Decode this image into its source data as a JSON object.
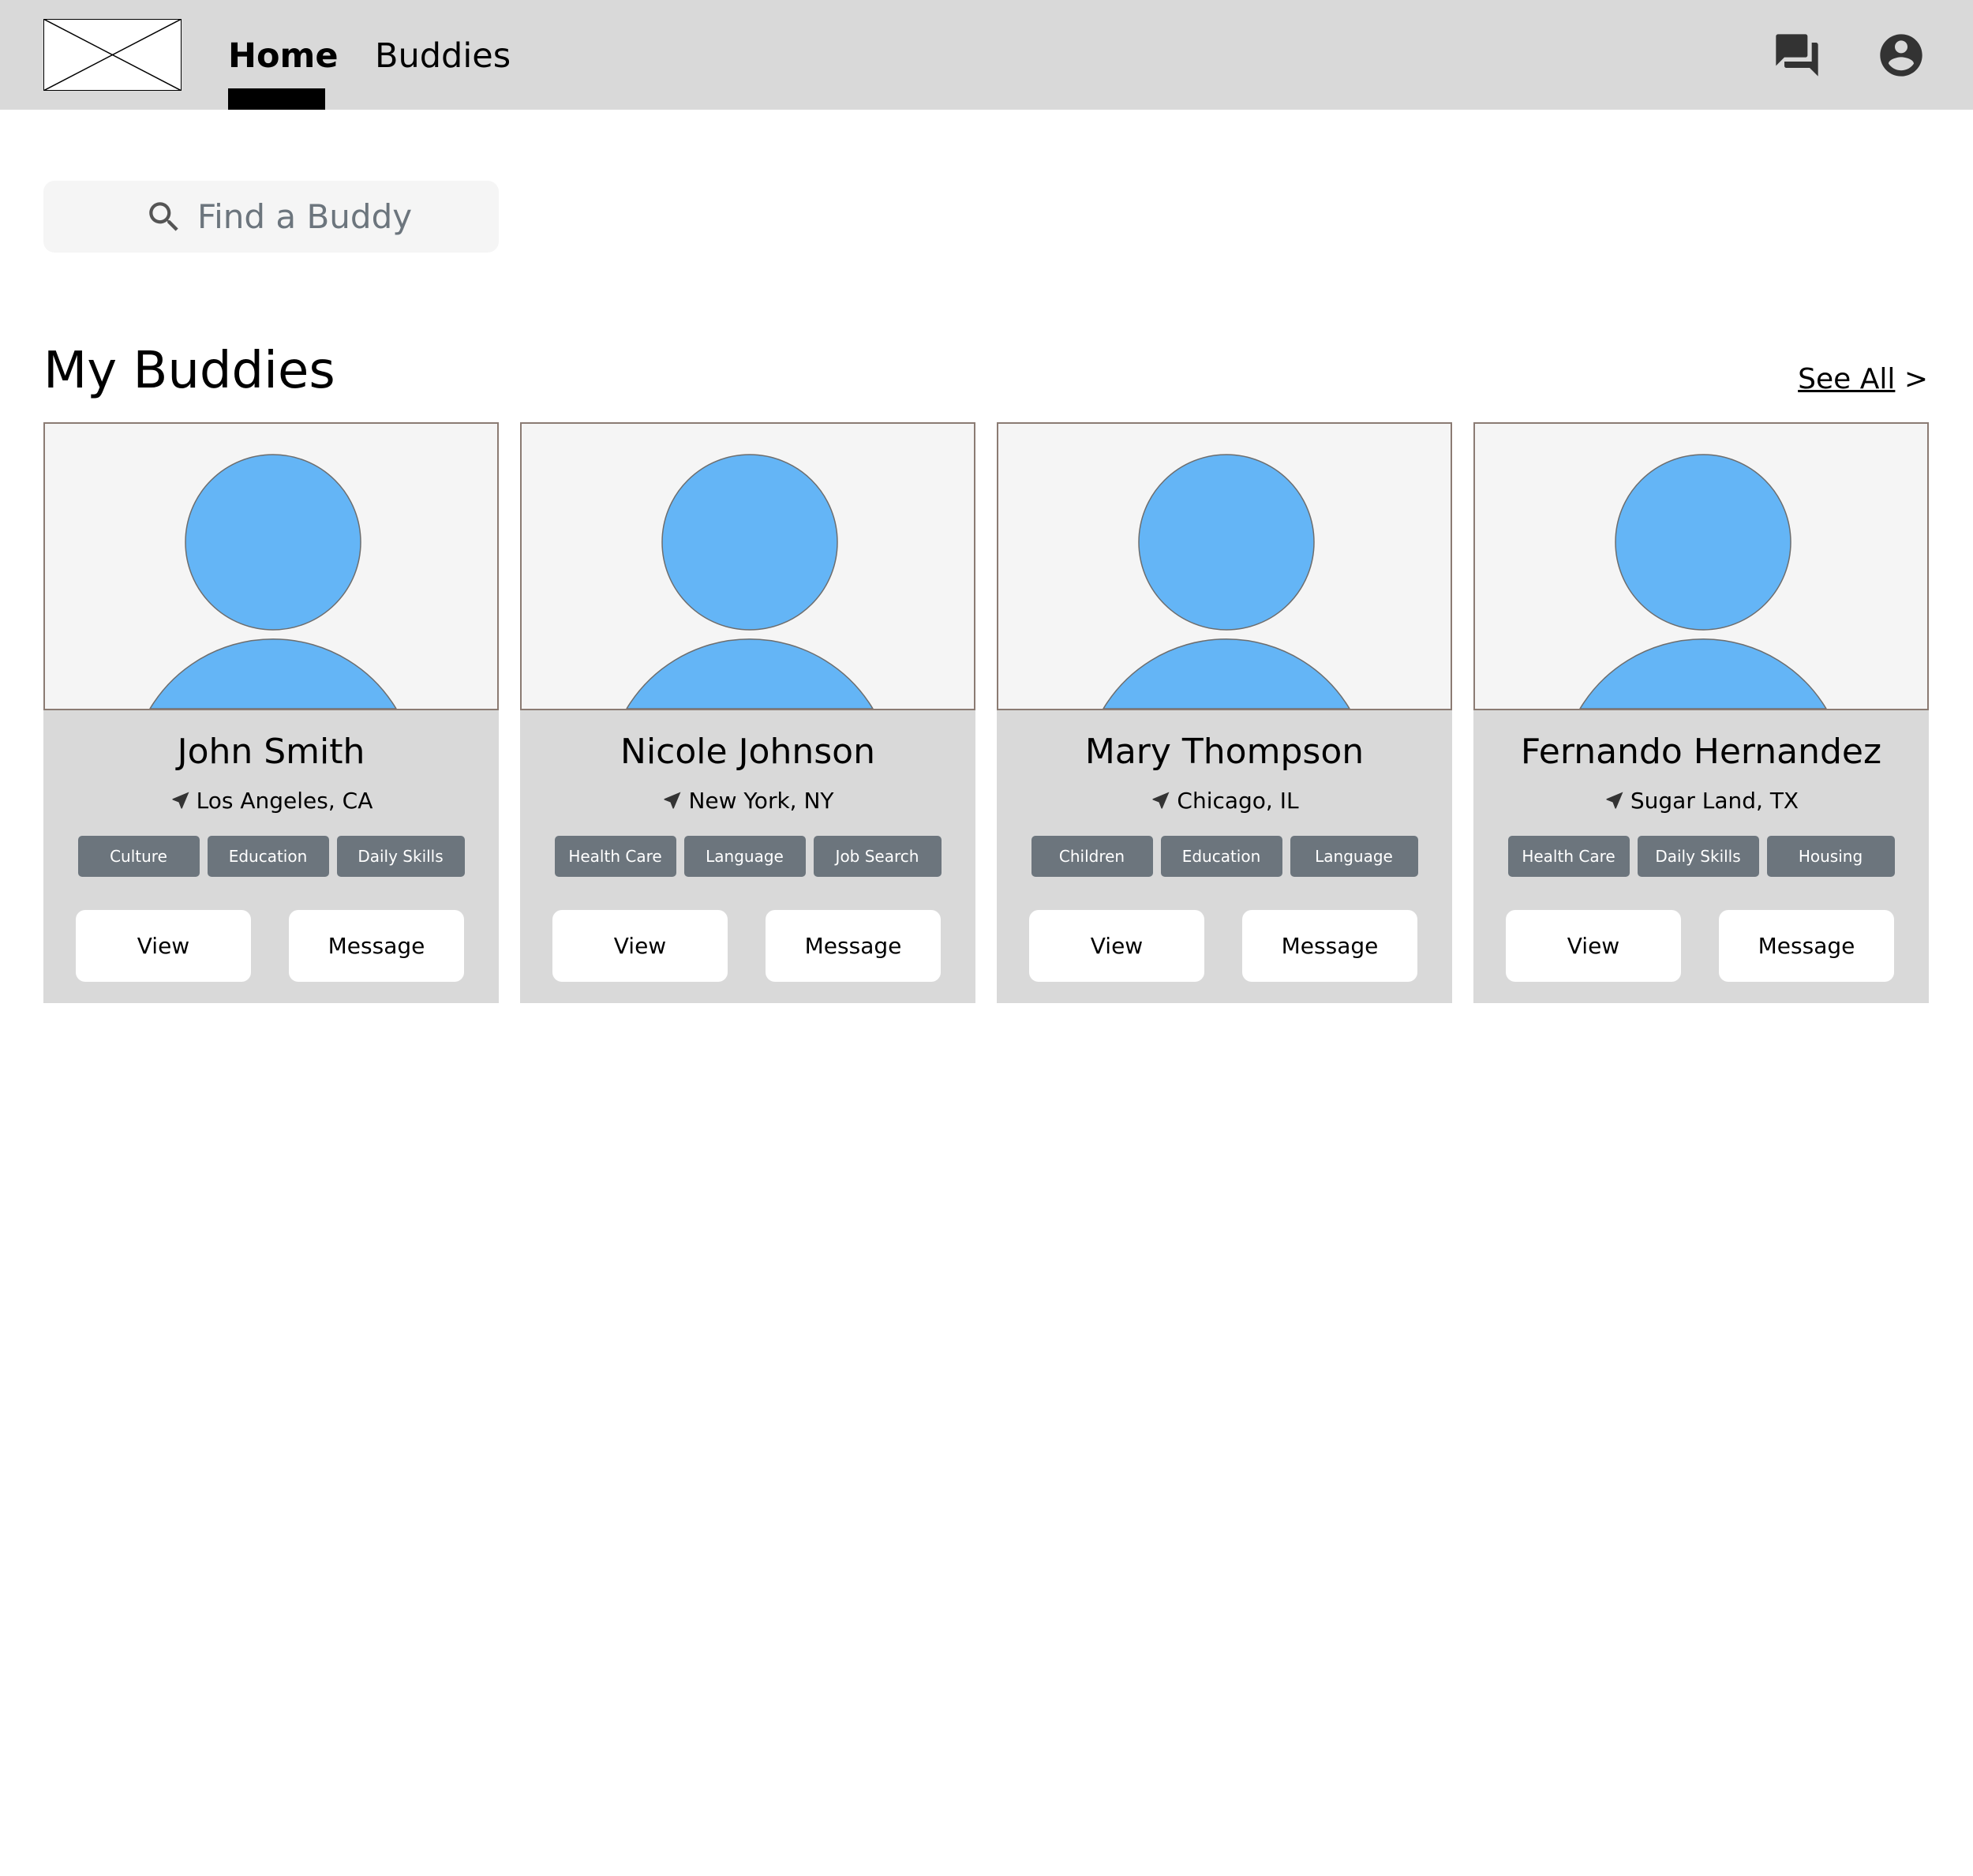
{
  "nav": {
    "tabs": [
      {
        "label": "Home",
        "active": true
      },
      {
        "label": "Buddies",
        "active": false
      }
    ],
    "icons": [
      "chat-icon",
      "account-circle-icon"
    ],
    "active_indicator_color": "#000000"
  },
  "search": {
    "placeholder": "Find a Buddy",
    "value": ""
  },
  "section": {
    "title": "My Buddies",
    "see_all_label": "See All",
    "see_all_arrow": ">"
  },
  "colors": {
    "navbar_bg": "#d9d9d9",
    "card_bg": "#d9d9d9",
    "tag_bg": "#6c757d",
    "avatar_fill": "#64b5f6",
    "search_bg": "#f5f5f5"
  },
  "buddies": [
    {
      "name": "John Smith",
      "location": "Los Angeles, CA",
      "tags": [
        "Culture",
        "Education",
        "Daily Skills"
      ],
      "view_label": "View",
      "message_label": "Message"
    },
    {
      "name": "Nicole Johnson",
      "location": "New York, NY",
      "tags": [
        "Health Care",
        "Language",
        "Job Search"
      ],
      "view_label": "View",
      "message_label": "Message"
    },
    {
      "name": "Mary Thompson",
      "location": "Chicago, IL",
      "tags": [
        "Children",
        "Education",
        "Language"
      ],
      "view_label": "View",
      "message_label": "Message"
    },
    {
      "name": "Fernando Hernandez",
      "location": "Sugar Land, TX",
      "tags": [
        "Health Care",
        "Daily Skills",
        "Housing"
      ],
      "view_label": "View",
      "message_label": "Message"
    }
  ]
}
